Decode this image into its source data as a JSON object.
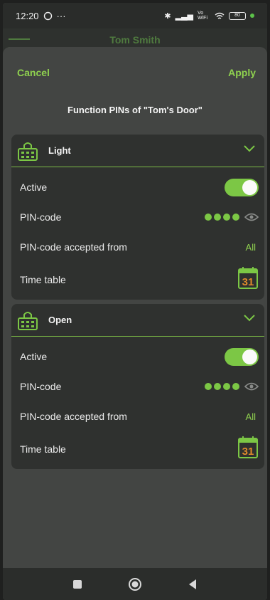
{
  "status": {
    "time": "12:20",
    "battery": "80",
    "net": "Vo WiFi"
  },
  "app_bar": {
    "title": "Tom Smith"
  },
  "sheet": {
    "cancel_label": "Cancel",
    "apply_label": "Apply",
    "title": "Function PINs of \"Tom's Door\""
  },
  "functions": [
    {
      "name": "Light",
      "active_label": "Active",
      "pin_label": "PIN-code",
      "accepted_label": "PIN-code accepted from",
      "accepted_value": "All",
      "timetable_label": "Time table",
      "calendar_day": "31",
      "active": true
    },
    {
      "name": "Open",
      "active_label": "Active",
      "pin_label": "PIN-code",
      "accepted_label": "PIN-code accepted from",
      "accepted_value": "All",
      "timetable_label": "Time table",
      "calendar_day": "31",
      "active": true
    }
  ],
  "icons": {
    "lock": "keypad-lock-icon",
    "chevron": "chevron-down-icon",
    "eye": "eye-icon",
    "calendar": "calendar-icon"
  },
  "colors": {
    "accent": "#7cc745",
    "text_accent": "#8fd14f",
    "card": "#2f312f",
    "sheet": "#434543"
  }
}
